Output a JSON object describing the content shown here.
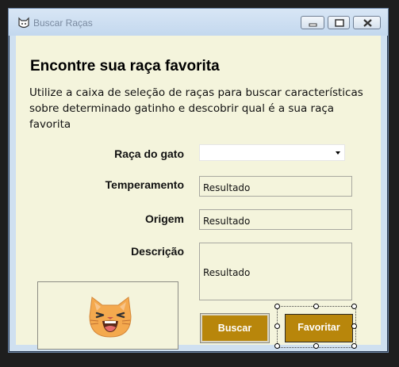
{
  "window": {
    "title": "Buscar Raças"
  },
  "heading": "Encontre sua raça favorita",
  "description": "Utilize a caixa de seleção de raças para buscar características sobre determinado gatinho e descobrir qual é a sua raça favorita",
  "form": {
    "breed_label": "Raça do gato",
    "breed_value": "",
    "temperament_label": "Temperamento",
    "temperament_value": "Resultado",
    "origin_label": "Origem",
    "origin_value": "Resultado",
    "description_label": "Descrição",
    "description_value": "Resultado"
  },
  "buttons": {
    "search": "Buscar",
    "favorite": "Favoritar"
  },
  "colors": {
    "client_bg": "#f4f4dc",
    "button_bg": "#b8860b",
    "button_text": "#ffffff"
  },
  "icons": {
    "app": "cat-head-icon",
    "image": "laughing-cat-face-icon"
  }
}
